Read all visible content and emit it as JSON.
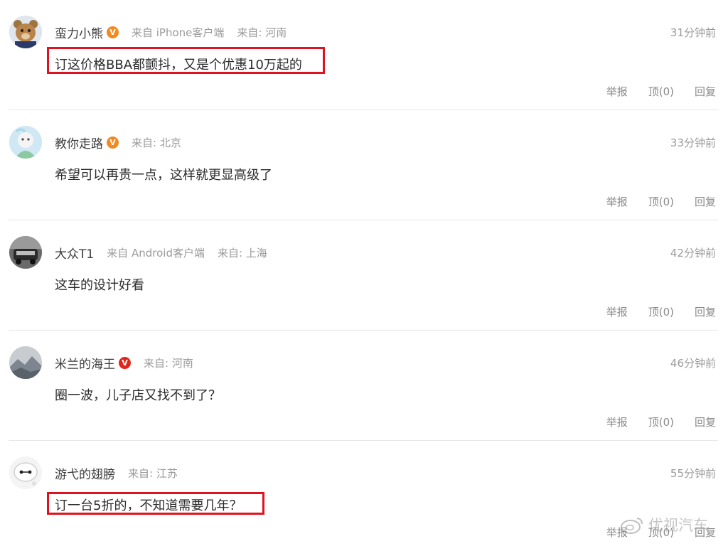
{
  "colors": {
    "highlight": "#e0121f",
    "verified_orange": "#f08a21",
    "verified_red": "#e2261c"
  },
  "comments": [
    {
      "username": "蛮力小熊",
      "verified": "V",
      "sources": [
        "来自 iPhone客户端",
        "来自: 河南"
      ],
      "time": "31分钟前",
      "text": "订这价格BBA都颤抖，又是个优惠10万起的",
      "report": "举报",
      "like": "顶(0)",
      "reply": "回复"
    },
    {
      "username": "教你走路",
      "verified": "V",
      "sources": [
        "来自: 北京"
      ],
      "time": "33分钟前",
      "text": "希望可以再贵一点，这样就更显高级了",
      "report": "举报",
      "like": "顶(0)",
      "reply": "回复"
    },
    {
      "username": "大众T1",
      "sources": [
        "来自 Android客户端",
        "来自: 上海"
      ],
      "time": "42分钟前",
      "text": "这车的设计好看",
      "report": "举报",
      "like": "顶(0)",
      "reply": "回复"
    },
    {
      "username": "米兰的海王",
      "verified": "V",
      "sources": [
        "来自: 河南"
      ],
      "time": "46分钟前",
      "text": "圈一波，儿子店又找不到了？",
      "report": "举报",
      "like": "顶(0)",
      "reply": "回复"
    },
    {
      "username": "游弋的翅膀",
      "sources": [
        "来自: 江苏"
      ],
      "time": "55分钟前",
      "text": "订一台5折的，不知道需要几年？",
      "report": "举报",
      "like": "顶(0)",
      "reply": "回复"
    }
  ],
  "watermark": {
    "text": "优视汽车",
    "icon": "weibo-icon"
  }
}
